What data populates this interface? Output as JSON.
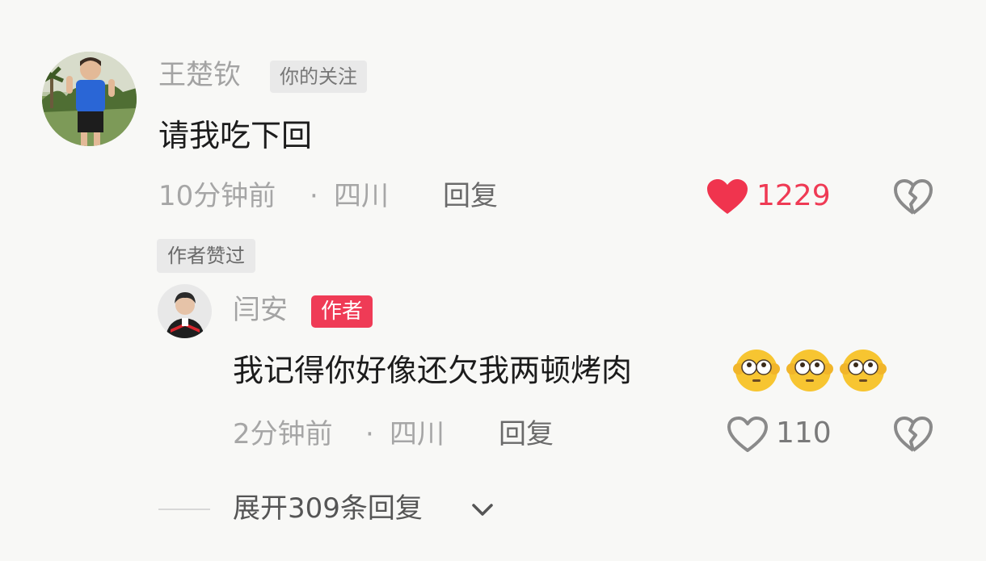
{
  "top_comment": {
    "username": "王楚钦",
    "follow_badge": "你的关注",
    "text": "请我吃下回",
    "time": "10分钟前",
    "separator": "·",
    "location": "四川",
    "reply_label": "回复",
    "like_count": "1229",
    "liked": true,
    "author_liked_badge": "作者赞过",
    "like_color": "#f0344e"
  },
  "reply_comment": {
    "username": "闫安",
    "author_badge": "作者",
    "text": "我记得你好像还欠我两顿烤肉",
    "emojis": [
      "flushed-face-icon",
      "flushed-face-icon",
      "flushed-face-icon"
    ],
    "time": "2分钟前",
    "separator": "·",
    "location": "四川",
    "reply_label": "回复",
    "like_count": "110",
    "liked": false
  },
  "expand_replies": {
    "label": "展开309条回复"
  },
  "icons": {
    "like": "heart-icon",
    "dislike": "broken-heart-icon",
    "expand": "chevron-down-icon"
  }
}
